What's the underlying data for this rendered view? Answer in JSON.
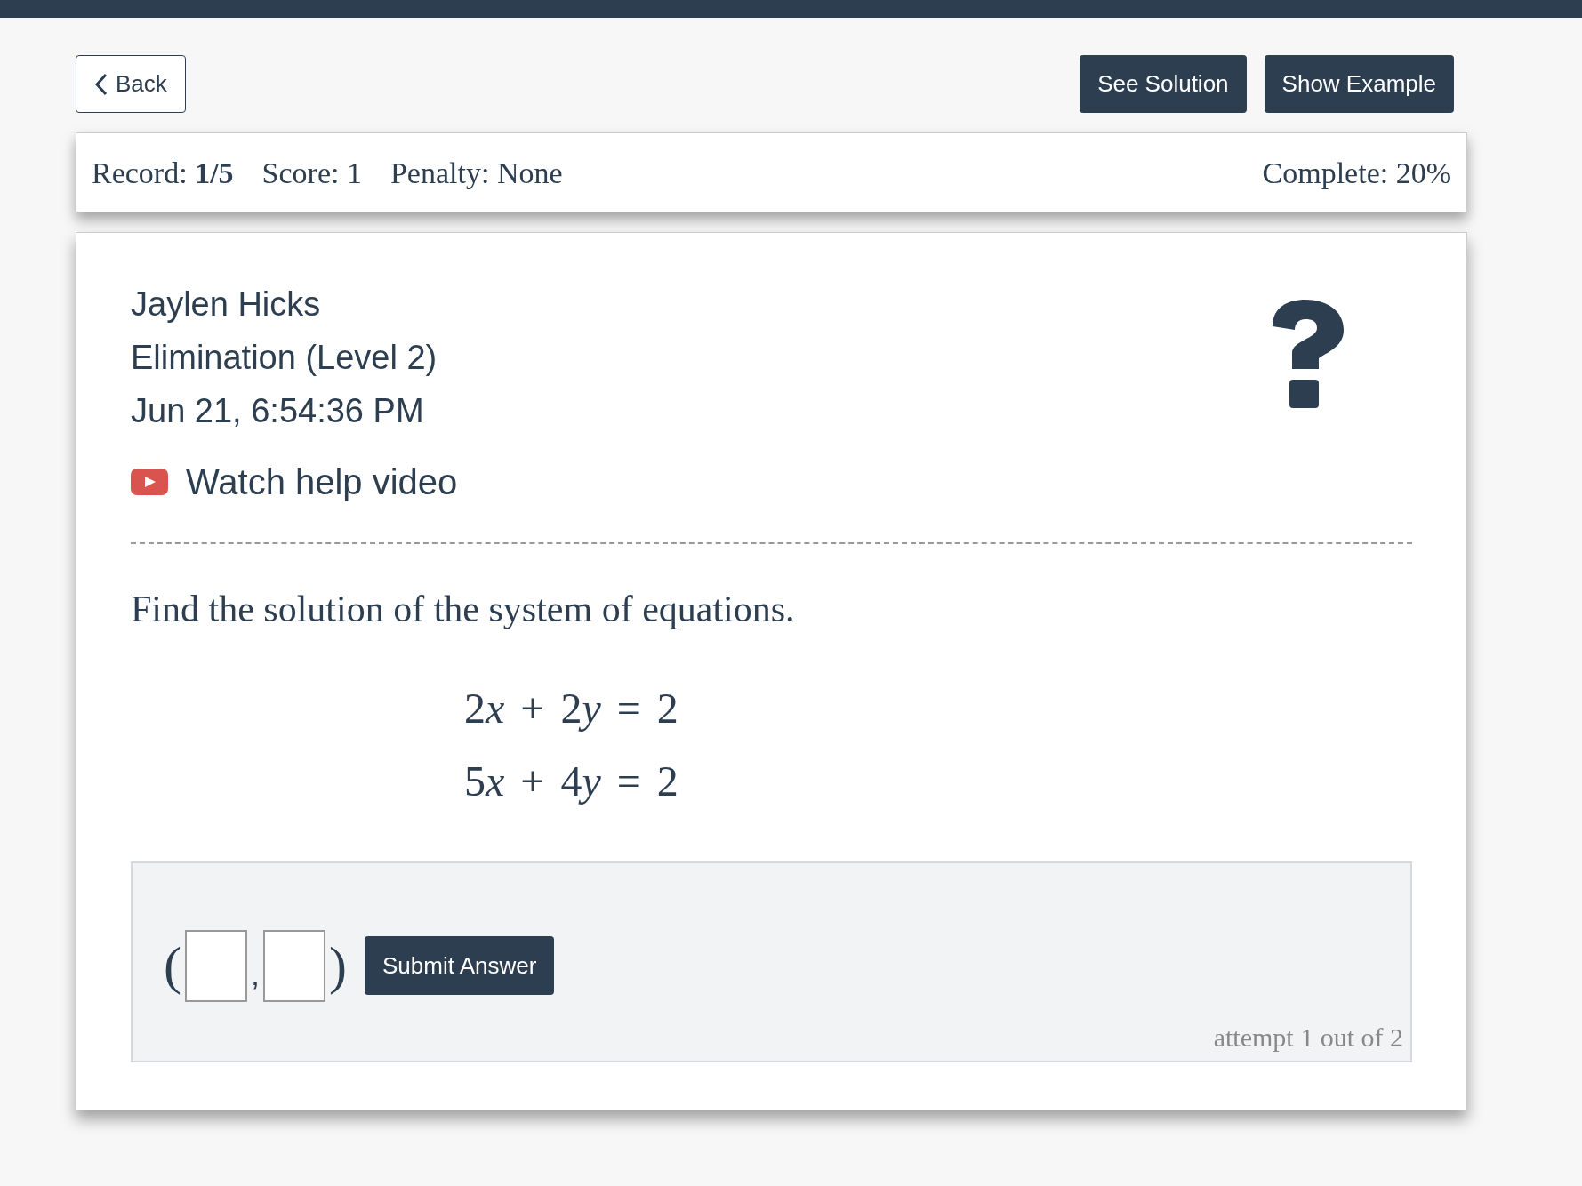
{
  "toolbar": {
    "back": "Back",
    "buttons": [
      "See Solution",
      "Show Example"
    ]
  },
  "stats": {
    "record": "Record: **1/5**",
    "score": "Score: 1",
    "penalty": "Penalty: None",
    "complete": "Complete: 20%"
  },
  "header": {
    "student": "Jaylen Hicks",
    "topic": "Elimination (Level 2)",
    "timestamp": "Jun 21, 6:54:36 PM",
    "video_link": "Watch help video"
  },
  "question": {
    "prompt": "Find the solution of the system of equations.",
    "equations": [
      {
        "tokens": [
          {
            "kind": "number",
            "text": "2"
          },
          {
            "kind": "variable",
            "text": "x"
          },
          {
            "kind": "operator",
            "text": "+"
          },
          {
            "kind": "number",
            "text": "2"
          },
          {
            "kind": "variable",
            "text": "y"
          },
          {
            "kind": "operator",
            "text": "="
          },
          {
            "kind": "number",
            "text": "2"
          }
        ]
      },
      {
        "tokens": [
          {
            "kind": "number",
            "text": "5"
          },
          {
            "kind": "variable",
            "text": "x"
          },
          {
            "kind": "operator",
            "text": "+"
          },
          {
            "kind": "number",
            "text": "4"
          },
          {
            "kind": "variable",
            "text": "y"
          },
          {
            "kind": "operator",
            "text": "="
          },
          {
            "kind": "number",
            "text": "2"
          }
        ]
      }
    ]
  },
  "answer": {
    "open": "(",
    "separator": ",",
    "close": ")",
    "submit": "Submit Answer",
    "attempt": "attempt 1 out of 2"
  }
}
